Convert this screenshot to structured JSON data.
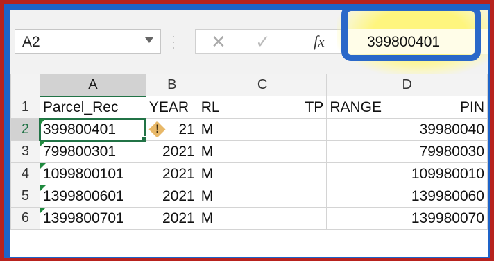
{
  "name_box": {
    "value": "A2"
  },
  "formula_bar": {
    "cancel_glyph": "✕",
    "enter_glyph": "✓",
    "fx_label": "fx",
    "value": "399800401"
  },
  "columns": [
    "A",
    "B",
    "C",
    "D"
  ],
  "rows": [
    {
      "num": "1",
      "a": "Parcel_Rec",
      "b": "YEAR",
      "c1": "RL",
      "c2": "TP",
      "d1": "RANGE",
      "d2": "PIN"
    },
    {
      "num": "2",
      "a": "399800401",
      "b": "21",
      "c1": "M",
      "c2": "",
      "d1": "",
      "d2": "39980040"
    },
    {
      "num": "3",
      "a": "799800301",
      "b": "2021",
      "c1": "M",
      "c2": "",
      "d1": "",
      "d2": "79980030"
    },
    {
      "num": "4",
      "a": "1099800101",
      "b": "2021",
      "c1": "M",
      "c2": "",
      "d1": "",
      "d2": "109980010"
    },
    {
      "num": "5",
      "a": "1399800601",
      "b": "2021",
      "c1": "M",
      "c2": "",
      "d1": "",
      "d2": "139980060"
    },
    {
      "num": "6",
      "a": "1399800701",
      "b": "2021",
      "c1": "M",
      "c2": "",
      "d1": "",
      "d2": "139980070"
    }
  ],
  "warning_glyph": "!",
  "colors": {
    "frame_red": "#b8221e",
    "frame_blue": "#1e63c8",
    "excel_green": "#217346",
    "highlight_yellow": "#fff578"
  }
}
